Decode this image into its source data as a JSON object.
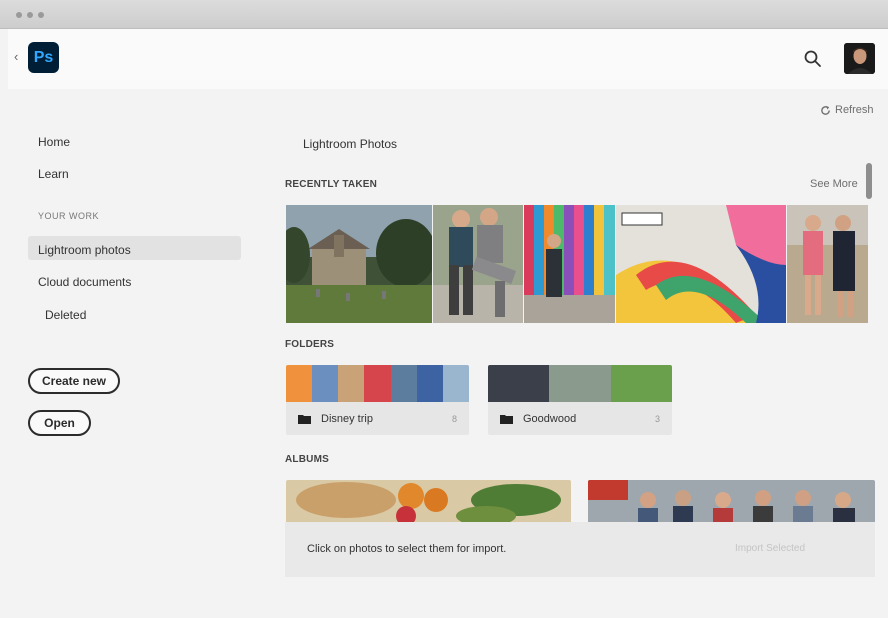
{
  "app": {
    "logo_text": "Ps",
    "back_icon": "chevron-left-icon",
    "search_icon": "search-icon",
    "avatar_icon": "user-avatar"
  },
  "sidebar": {
    "items": [
      {
        "label": "Home"
      },
      {
        "label": "Learn"
      }
    ],
    "section_title": "YOUR WORK",
    "work_items": [
      {
        "label": "Lightroom photos",
        "active": true
      },
      {
        "label": "Cloud documents"
      },
      {
        "label": "Deleted"
      }
    ],
    "create_new_label": "Create new",
    "open_label": "Open"
  },
  "main": {
    "refresh_label": "Refresh",
    "refresh_icon": "refresh-icon",
    "heading": "Lightroom Photos",
    "recently_taken_label": "RECENTLY TAKEN",
    "see_more_label": "See More",
    "folders_label": "FOLDERS",
    "folders": [
      {
        "name": "Disney trip",
        "count": "8"
      },
      {
        "name": "Goodwood",
        "count": "3"
      }
    ],
    "albums_label": "ALBUMS",
    "import_hint": "Click on photos to select them for import.",
    "import_button": "Import Selected"
  },
  "colors": {
    "accent_ps_bg": "#001e36",
    "accent_ps_fg": "#31a8ff",
    "sidebar_active": "#e2e2e2"
  }
}
